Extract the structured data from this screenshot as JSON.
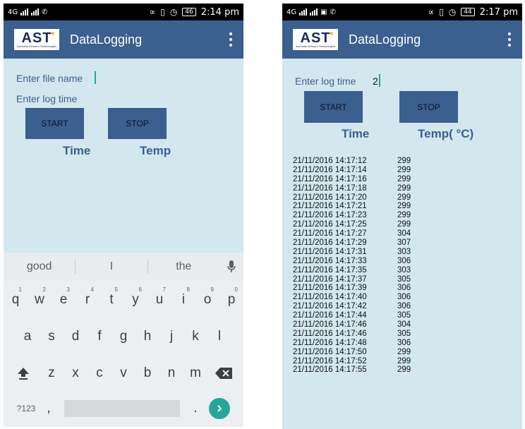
{
  "left": {
    "status": {
      "network": "4G",
      "time": "2:14 pm",
      "battery": "46"
    },
    "app_title": "DataLogging",
    "logo": {
      "text": "AST",
      "subtitle": "Accurate Sensors Technologies"
    },
    "file_name_label": "Enter file name",
    "log_time_label": "Enter log time",
    "start_label": "START",
    "stop_label": "STOP",
    "time_header": "Time",
    "temp_header": "Temp",
    "keyboard": {
      "suggestions": [
        "good",
        "I",
        "the"
      ],
      "row1": [
        "q",
        "w",
        "e",
        "r",
        "t",
        "y",
        "u",
        "i",
        "o",
        "p"
      ],
      "row1_digits": [
        "1",
        "2",
        "3",
        "4",
        "5",
        "6",
        "7",
        "8",
        "9",
        "0"
      ],
      "row2": [
        "a",
        "s",
        "d",
        "f",
        "g",
        "h",
        "j",
        "k",
        "l"
      ],
      "row3": [
        "z",
        "x",
        "c",
        "v",
        "b",
        "n",
        "m"
      ],
      "symbols_key": "?123",
      "comma_key": ",",
      "period_key": "."
    }
  },
  "right": {
    "status": {
      "network": "4G",
      "time": "2:17 pm",
      "battery": "44"
    },
    "app_title": "DataLogging",
    "logo": {
      "text": "AST",
      "subtitle": "Accurate Sensors Technologies"
    },
    "log_time_label": "Enter log time",
    "log_time_value": "2",
    "start_label": "START",
    "stop_label": "STOP",
    "time_header": "Time",
    "temp_header": "Temp( °C)",
    "log_entries": [
      {
        "time": "21/11/2016  14:17:12",
        "temp": "299"
      },
      {
        "time": "21/11/2016  14:17:14",
        "temp": "299"
      },
      {
        "time": "21/11/2016  14:17:16",
        "temp": "299"
      },
      {
        "time": "21/11/2016  14:17:18",
        "temp": "299"
      },
      {
        "time": "21/11/2016  14:17:20",
        "temp": "299"
      },
      {
        "time": "21/11/2016  14:17:21",
        "temp": "299"
      },
      {
        "time": "21/11/2016  14:17:23",
        "temp": "299"
      },
      {
        "time": "21/11/2016  14:17:25",
        "temp": "299"
      },
      {
        "time": "21/11/2016  14:17:27",
        "temp": "304"
      },
      {
        "time": "21/11/2016  14:17:29",
        "temp": "307"
      },
      {
        "time": "21/11/2016  14:17:31",
        "temp": "303"
      },
      {
        "time": "21/11/2016  14:17:33",
        "temp": "306"
      },
      {
        "time": "21/11/2016  14:17:35",
        "temp": "303"
      },
      {
        "time": "21/11/2016  14:17:37",
        "temp": "305"
      },
      {
        "time": "21/11/2016  14:17:39",
        "temp": "306"
      },
      {
        "time": "21/11/2016  14:17:40",
        "temp": "306"
      },
      {
        "time": "21/11/2016  14:17:42",
        "temp": "306"
      },
      {
        "time": "21/11/2016  14:17:44",
        "temp": "305"
      },
      {
        "time": "21/11/2016  14:17:46",
        "temp": "304"
      },
      {
        "time": "21/11/2016  14:17:46",
        "temp": "305"
      },
      {
        "time": "21/11/2016  14:17:48",
        "temp": "306"
      },
      {
        "time": "21/11/2016  14:17:50",
        "temp": "299"
      },
      {
        "time": "21/11/2016  14:17:52",
        "temp": "299"
      },
      {
        "time": "21/11/2016  14:17:55",
        "temp": "299"
      }
    ]
  },
  "colors": {
    "appbar": "#3b5f8f",
    "background": "#d2e7ee",
    "accent_teal": "#26a69a",
    "header_text": "#3b5f8f"
  }
}
